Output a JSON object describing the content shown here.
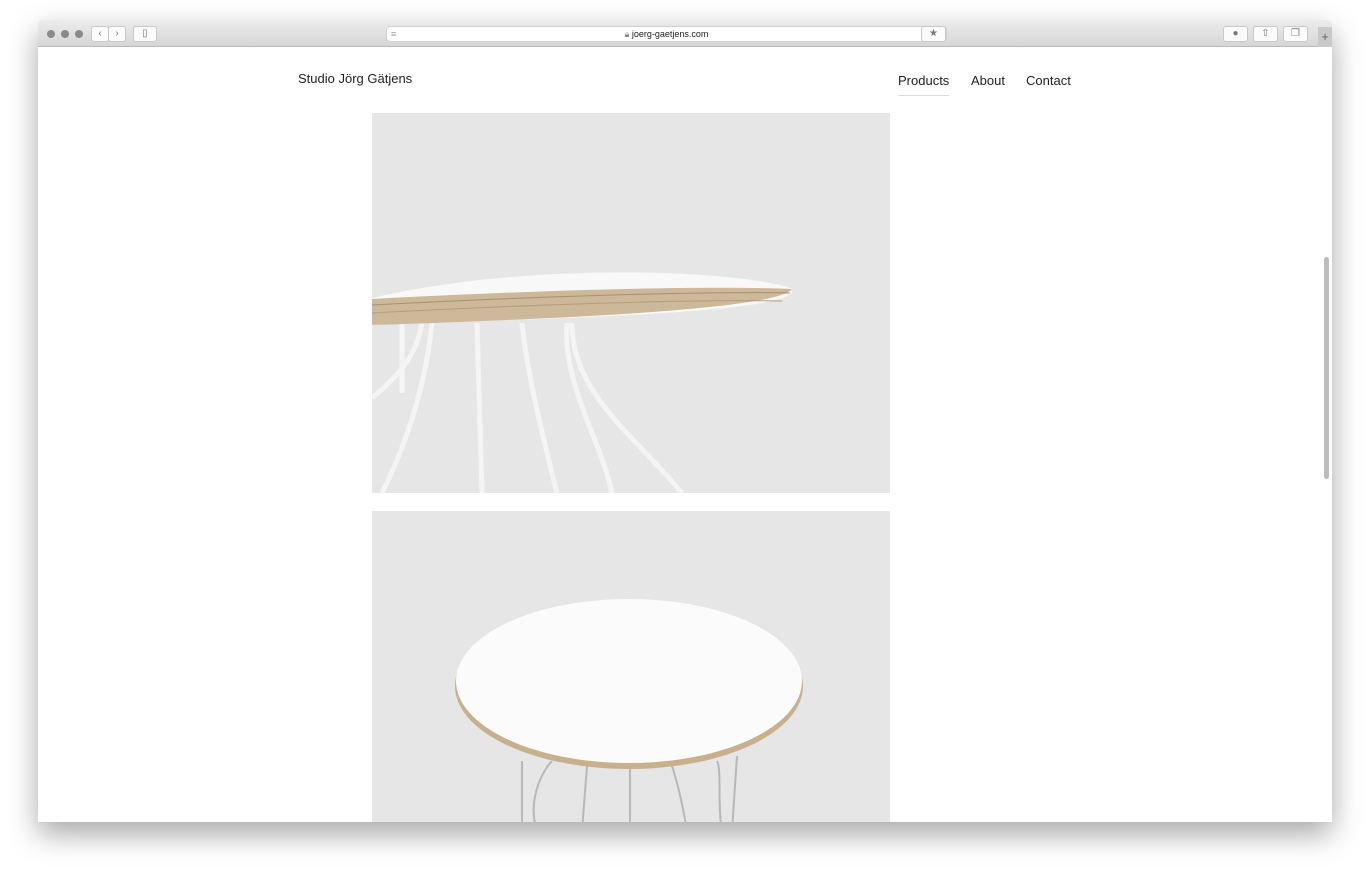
{
  "browser": {
    "url": "joerg-gaetjens.com"
  },
  "site": {
    "logo": "Studio Jörg Gätjens",
    "nav": [
      {
        "label": "Products",
        "active": true
      },
      {
        "label": "About"
      },
      {
        "label": "Contact"
      }
    ]
  },
  "images": [
    "table-side-detail",
    "table-top-view"
  ]
}
